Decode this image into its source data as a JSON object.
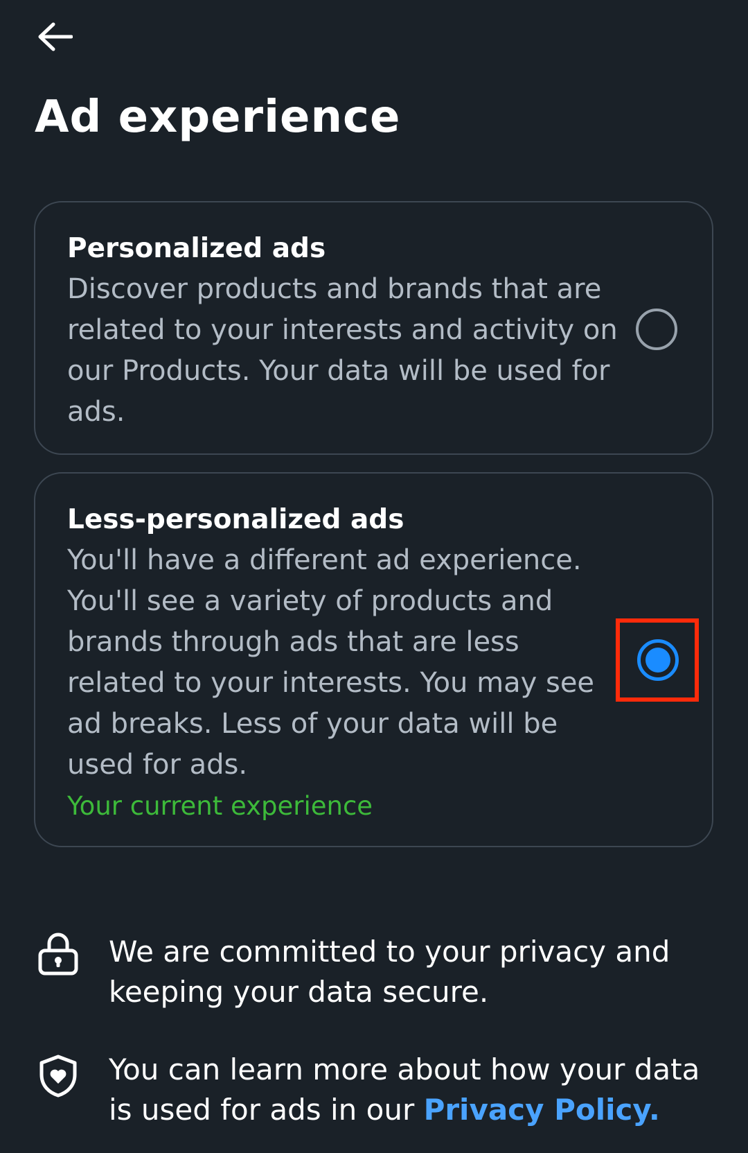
{
  "header": {
    "back_icon": "arrow-left-icon",
    "title": "Ad experience"
  },
  "options": [
    {
      "title": "Personalized ads",
      "description": "Discover products and brands that are related to your interests and activity on our Products. Your data will be used for ads.",
      "selected": false
    },
    {
      "title": "Less-personalized ads",
      "description": "You'll have a different ad experience. You'll see a variety of products and brands through ads that are less related to your interests. You may see ad breaks. Less of your data will be used for ads.",
      "status": "Your current experience",
      "selected": true
    }
  ],
  "info": [
    {
      "icon": "lock-icon",
      "text": "We are committed to your privacy and keeping your data secure."
    },
    {
      "icon": "shield-heart-icon",
      "text_prefix": "You can learn more about how your data is used for ads in our ",
      "link_label": "Privacy Policy."
    }
  ],
  "colors": {
    "background": "#1a2128",
    "card_border": "#3d4752",
    "description": "#b3bcc6",
    "status": "#3dba3a",
    "radio_selected": "#1a8cff",
    "highlight_box": "#ff2b0a",
    "link": "#4aa3ff"
  }
}
